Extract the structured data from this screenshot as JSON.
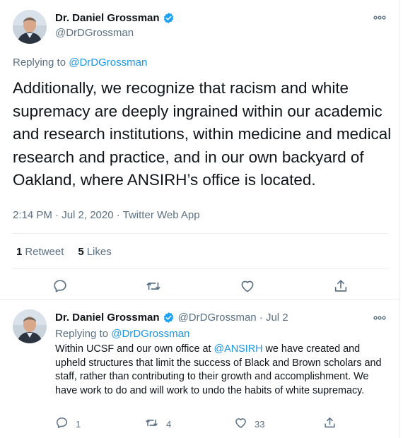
{
  "main_tweet": {
    "author_name": "Dr. Daniel Grossman",
    "handle": "@DrDGrossman",
    "replying_prefix": "Replying to ",
    "replying_to": "@DrDGrossman",
    "text": "Additionally, we recognize that racism and white supremacy are deeply ingrained within our academic and research institutions, within medicine and medical research and practice, and in our own backyard of Oakland, where ANSIRH’s office is located.",
    "time": "2:14 PM · Jul 2, 2020 · Twitter Web App",
    "retweets_count": "1",
    "retweets_label": "Retweet",
    "likes_count": "5",
    "likes_label": "Likes",
    "icons": {
      "verified": "verified-badge-icon",
      "more": "more-options-icon",
      "reply": "reply-icon",
      "retweet": "retweet-icon",
      "like": "heart-icon",
      "share": "share-icon"
    }
  },
  "reply_tweet": {
    "author_name": "Dr. Daniel Grossman",
    "handle_and_date": "@DrDGrossman · Jul 2",
    "replying_prefix": "Replying to ",
    "replying_to": "@DrDGrossman",
    "text_before_mention": "Within UCSF and our own office at ",
    "mention": "@ANSIRH",
    "text_after_mention": " we have created and upheld structures that limit the success of Black and Brown scholars and staff, rather than contributing to their growth and accomplishment. We have work to do and will work to undo the habits of white supremacy.",
    "reply_count": "1",
    "retweet_count": "4",
    "like_count": "33"
  },
  "colors": {
    "text": "#0f1419",
    "muted": "#5b7083",
    "link": "#1b95e0",
    "verified": "#1da1f2",
    "divider": "#ebeef0"
  }
}
